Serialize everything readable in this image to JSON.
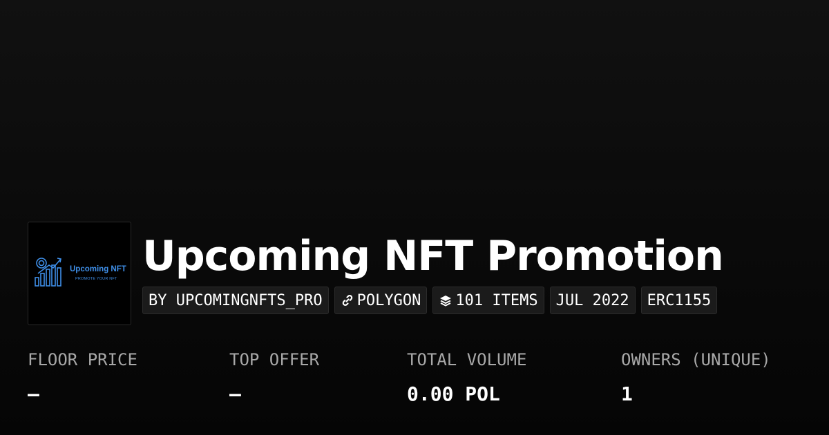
{
  "collection": {
    "title": "Upcoming NFT Promotion",
    "logo": {
      "title": "Upcoming NFT",
      "tagline": "PROMOTE YOUR NFT",
      "accent_color": "#3f8fe8"
    }
  },
  "badges": {
    "creator": "BY UPCOMINGNFTS_PRO",
    "chain": "POLYGON",
    "chain_icon": "link-icon",
    "items": "101 ITEMS",
    "items_icon": "layers-icon",
    "date": "JUL 2022",
    "standard": "ERC1155"
  },
  "stats": {
    "floor_price": {
      "label": "FLOOR PRICE",
      "value": "–"
    },
    "top_offer": {
      "label": "TOP OFFER",
      "value": "–"
    },
    "total_volume": {
      "label": "TOTAL VOLUME",
      "value": "0.00 POL"
    },
    "owners": {
      "label": "OWNERS (UNIQUE)",
      "value": "1"
    }
  },
  "colors": {
    "background": "#0d0d0d",
    "badge_background": "#1b1b1b",
    "label_gray": "#a8a8a8",
    "text": "#ffffff"
  }
}
